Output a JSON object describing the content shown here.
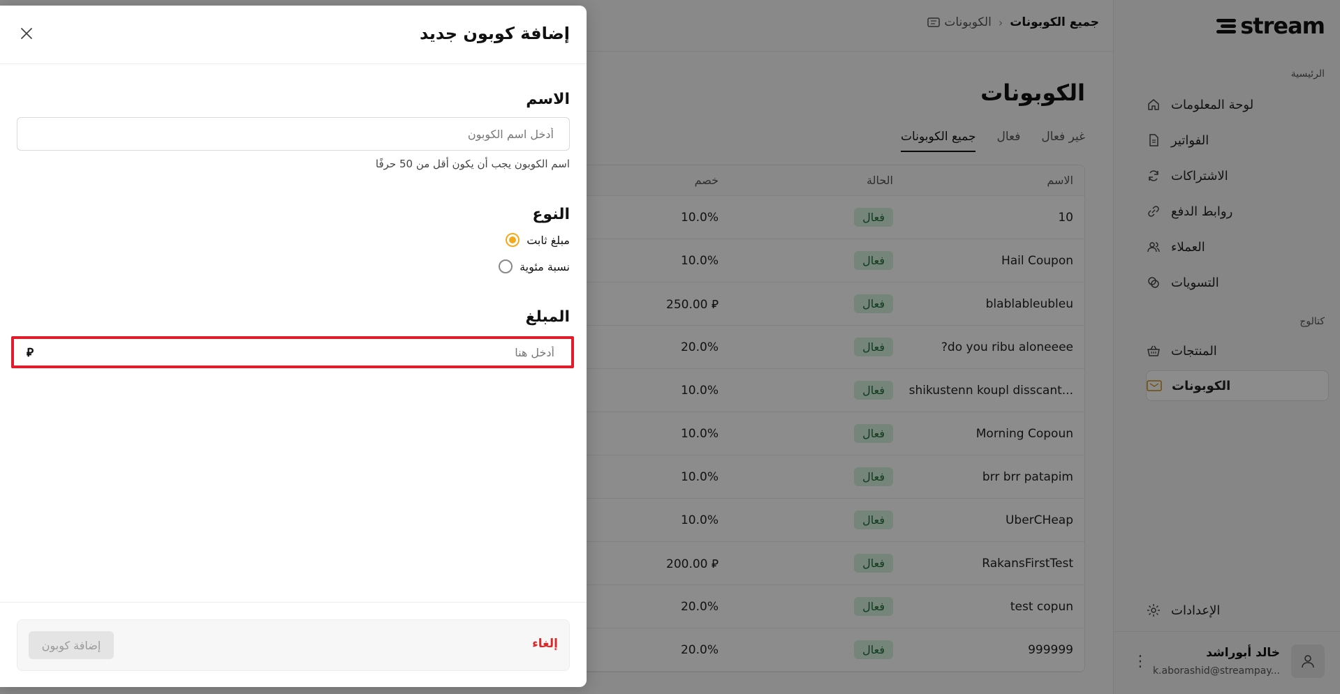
{
  "breadcrumb": {
    "root": "الكوبونات",
    "current": "جميع الكوبونات"
  },
  "logo": {
    "text": "stream"
  },
  "sidebar": {
    "sections": {
      "home": "الرئيسية",
      "catalog": "كتالوج"
    },
    "items": [
      {
        "label": "لوحة المعلومات",
        "icon": "home-icon"
      },
      {
        "label": "الفواتير",
        "icon": "invoice-icon"
      },
      {
        "label": "الاشتراكات",
        "icon": "refresh-icon"
      },
      {
        "label": "روابط الدفع",
        "icon": "link-icon"
      },
      {
        "label": "العملاء",
        "icon": "users-icon"
      },
      {
        "label": "التسويات",
        "icon": "coins-icon"
      },
      {
        "label": "المنتجات",
        "icon": "basket-icon"
      },
      {
        "label": "الكوبونات",
        "icon": "ticket-icon",
        "active": true
      }
    ],
    "settings": "الإعدادات",
    "user": {
      "name": "خالد أبوراشد",
      "email": "k.aborashid@streampay..."
    }
  },
  "main": {
    "title": "الكوبونات",
    "tabs": [
      "جميع الكوبونات",
      "فعال",
      "غير فعال"
    ],
    "table": {
      "headers": {
        "name": "الاسم",
        "status": "الحالة",
        "discount": "خصم"
      },
      "rows": [
        {
          "name": "10",
          "status": "فعال",
          "discount": "10.0%"
        },
        {
          "name": "Hail Coupon",
          "status": "فعال",
          "discount": "10.0%"
        },
        {
          "name": "blablableubleu",
          "status": "فعال",
          "discount": "250.00 ⃁"
        },
        {
          "name": "?do you ribu aloneeee",
          "status": "فعال",
          "discount": "20.0%"
        },
        {
          "name": "shikustenn koupl disscant...",
          "status": "فعال",
          "discount": "10.0%"
        },
        {
          "name": "Morning Copoun",
          "status": "فعال",
          "discount": "10.0%"
        },
        {
          "name": "brr brr patapim",
          "status": "فعال",
          "discount": "10.0%"
        },
        {
          "name": "UberCHeap",
          "status": "فعال",
          "discount": "10.0%"
        },
        {
          "name": "RakansFirstTest",
          "status": "فعال",
          "discount": "200.00 ⃁"
        },
        {
          "name": "test copun",
          "status": "فعال",
          "discount": "20.0%"
        },
        {
          "name": "999999",
          "status": "فعال",
          "discount": "20.0%"
        }
      ]
    }
  },
  "modal": {
    "title": "إضافة كوبون جديد",
    "name_label": "الاسم",
    "name_placeholder": "أدخل اسم الكوبون",
    "name_helper": "اسم الكوبون يجب أن يكون أقل من 50 حرفًا",
    "type_label": "النوع",
    "type_options": [
      {
        "label": "مبلغ ثابت",
        "checked": true
      },
      {
        "label": "نسبة مئوية",
        "checked": false
      }
    ],
    "amount_label": "المبلغ",
    "amount_placeholder": "أدخل هنا",
    "currency_symbol": "⃁",
    "cancel_label": "إلغاء",
    "submit_label": "إضافة كوبون"
  },
  "colors": {
    "accent": "#f2a91d",
    "danger": "#e01e2b",
    "badge_bg": "#d6f2dd",
    "badge_text": "#1c6b36"
  }
}
